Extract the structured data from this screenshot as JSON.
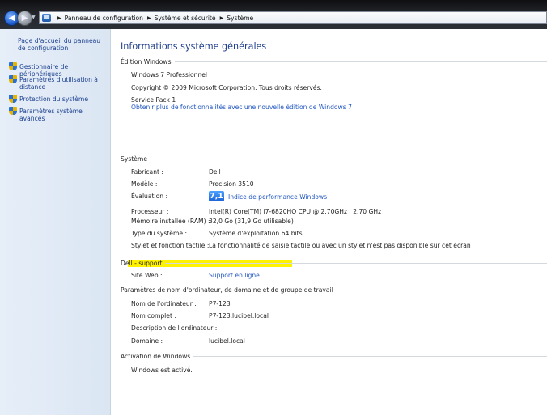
{
  "address_bar": {
    "crumbs": [
      "Panneau de configuration",
      "Système et sécurité",
      "Système"
    ]
  },
  "sidebar": {
    "home_link": "Page d'accueil du panneau de configuration",
    "items": [
      {
        "label": "Gestionnaire de périphériques",
        "icon": "shield-icon"
      },
      {
        "label": "Paramètres d'utilisation à distance",
        "icon": "shield-icon"
      },
      {
        "label": "Protection du système",
        "icon": "shield-icon"
      },
      {
        "label": "Paramètres système avancés",
        "icon": "shield-icon"
      }
    ]
  },
  "main": {
    "title": "Informations système générales",
    "windows_edition": {
      "header": "Édition Windows",
      "edition": "Windows 7 Professionnel",
      "copyright": "Copyright © 2009 Microsoft Corporation. Tous droits réservés.",
      "service_pack": "Service Pack 1",
      "upgrade_link": "Obtenir plus de fonctionnalités avec une nouvelle édition de Windows 7"
    },
    "system": {
      "header": "Système",
      "rows": [
        {
          "label": "Fabricant :",
          "value": "Dell"
        },
        {
          "label": "Modèle :",
          "value": "Precision 3510"
        },
        {
          "label": "Évaluation :",
          "value": "Indice de performance Windows",
          "badge": "7,1"
        },
        {
          "label": "Processeur :",
          "value": "Intel(R) Core(TM) i7-6820HQ CPU @ 2.70GHz   2.70 GHz"
        },
        {
          "label": "Mémoire installée (RAM) :",
          "value": "32,0 Go (31,9 Go utilisable)"
        },
        {
          "label": "Type du système :",
          "value": "Système d'exploitation 64 bits"
        },
        {
          "label": "Stylet et fonction tactile :",
          "value": "La fonctionnalité de saisie tactile ou avec un stylet n'est pas disponible sur cet écran"
        }
      ]
    },
    "dell_support": {
      "header": "Dell - support",
      "site_label": "Site Web :",
      "site_value": "Support en ligne"
    },
    "computer_name": {
      "header": "Paramètres de nom d'ordinateur, de domaine et de groupe de travail",
      "rows": [
        {
          "label": "Nom de l'ordinateur :",
          "value": "P7-123"
        },
        {
          "label": "Nom complet :",
          "value": "P7-123.lucibel.local"
        },
        {
          "label": "Description de l'ordinateur :",
          "value": ""
        },
        {
          "label": "Domaine :",
          "value": "lucibel.local"
        }
      ]
    },
    "activation": {
      "header": "Activation de Windows",
      "status": "Windows est activé."
    }
  },
  "colors": {
    "link": "#1f55c1",
    "title": "#1f3e8c",
    "highlight": "#fff200",
    "sidebar_bg": "#e6eef8"
  }
}
